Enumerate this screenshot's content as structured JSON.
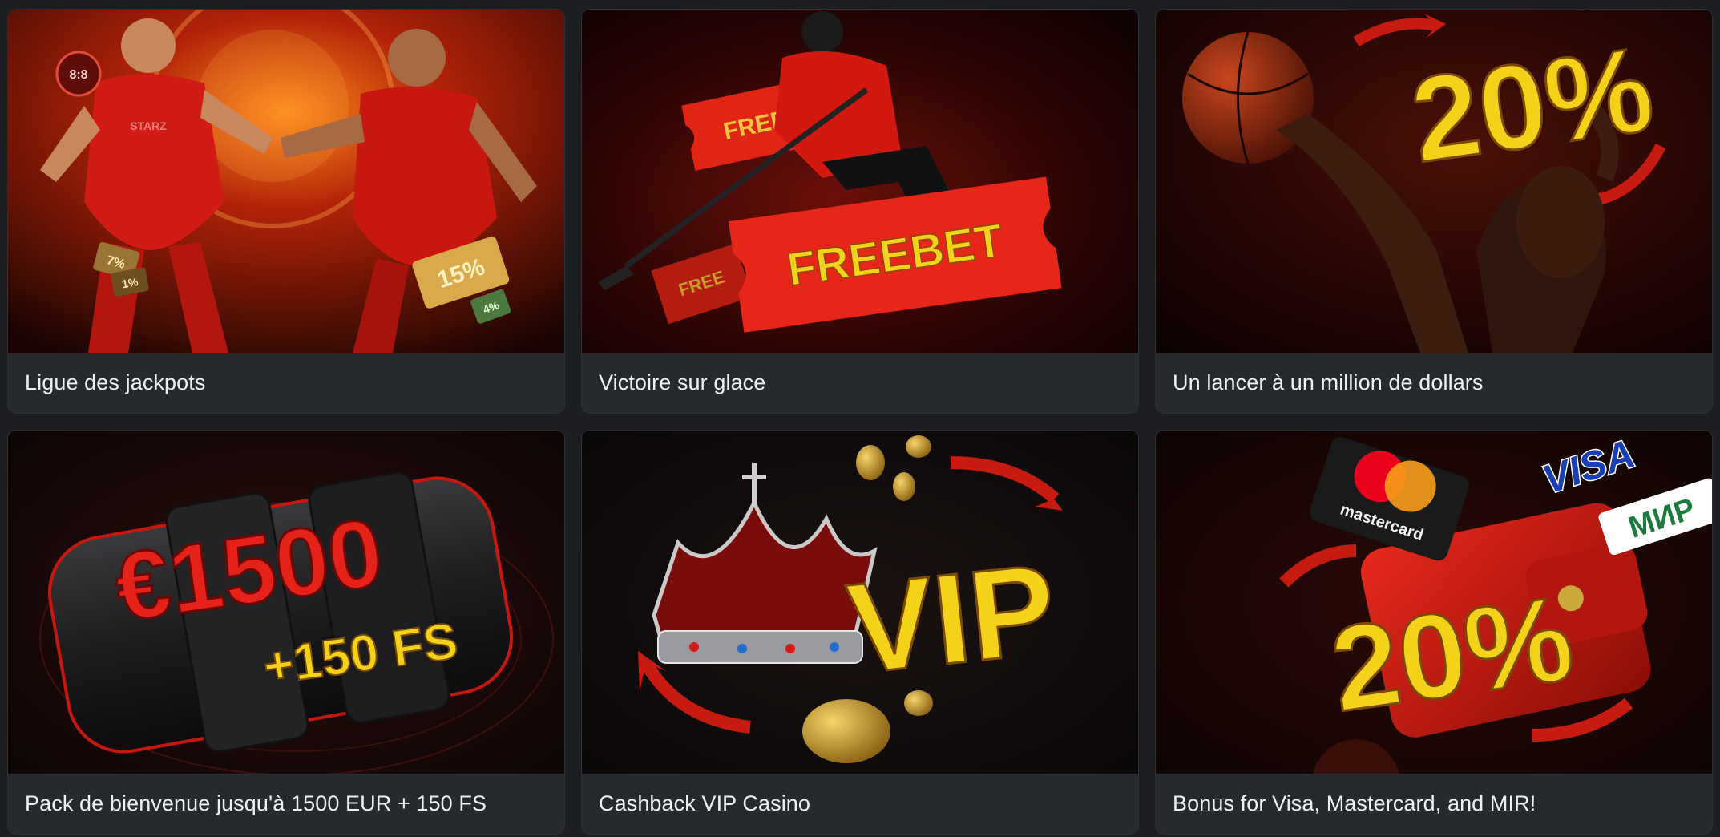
{
  "promos": [
    {
      "title": "Ligue des jackpots",
      "art": {
        "badge_top": "8:8",
        "badge_sub": "STARZ",
        "pct_big": "15%",
        "pct_a": "7%",
        "pct_b": "1%",
        "pct_c": "4%"
      }
    },
    {
      "title": "Victoire sur glace",
      "art": {
        "ticket_main": "FREEBET",
        "ticket_top": "FREEBET",
        "ticket_small": "FREE"
      }
    },
    {
      "title": "Un lancer à un million de dollars",
      "art": {
        "percent": "20%"
      }
    },
    {
      "title": "Pack de bienvenue jusqu'à 1500 EUR + 150 FS",
      "art": {
        "amount": "€1500",
        "spins": "+150 FS"
      }
    },
    {
      "title": "Cashback VIP Casino",
      "art": {
        "badge": "VIP"
      }
    },
    {
      "title": "Bonus for Visa, Mastercard, and MIR!",
      "art": {
        "percent": "20%",
        "brand_visa": "VISA",
        "brand_mc": "mastercard",
        "brand_mir": "МИР"
      }
    }
  ],
  "colors": {
    "background": "#1b1d20",
    "card": "#26292e",
    "accent_red": "#d4160f",
    "accent_yellow": "#f5d21a",
    "title_text": "#eef0f2"
  }
}
